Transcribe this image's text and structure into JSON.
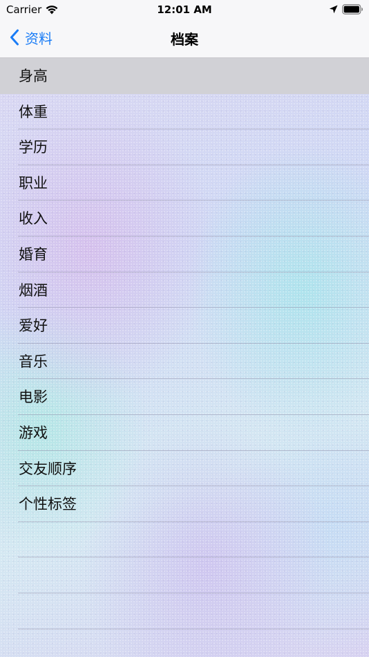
{
  "status_bar": {
    "carrier": "Carrier",
    "time": "12:01 AM",
    "icons": [
      "wifi-icon",
      "location-arrow-icon",
      "battery-icon"
    ]
  },
  "nav": {
    "back_label": "资料",
    "title": "档案",
    "back_icon": "chevron-left-icon",
    "accent_color": "#1a7cf6"
  },
  "list": {
    "selected_index": 0,
    "selected_color": "#d1d1d6",
    "items": [
      {
        "label": "身高"
      },
      {
        "label": "体重"
      },
      {
        "label": "学历"
      },
      {
        "label": "职业"
      },
      {
        "label": "收入"
      },
      {
        "label": "婚育"
      },
      {
        "label": "烟酒"
      },
      {
        "label": "爱好"
      },
      {
        "label": "音乐"
      },
      {
        "label": "电影"
      },
      {
        "label": "游戏"
      },
      {
        "label": "交友顺序"
      },
      {
        "label": "个性标签"
      }
    ]
  }
}
